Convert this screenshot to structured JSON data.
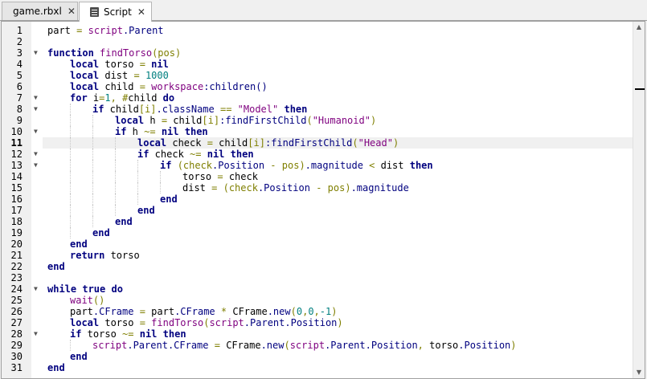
{
  "tabs": [
    {
      "label": "game.rbxl",
      "active": false,
      "close": "✕"
    },
    {
      "label": "Script",
      "active": true,
      "close": "✕"
    }
  ],
  "editor": {
    "current_line": 11,
    "lines": [
      {
        "n": "1",
        "fold": "",
        "indent": 0,
        "tokens": [
          [
            "part",
            "t"
          ],
          [
            " = ",
            "o"
          ],
          [
            "script",
            "b"
          ],
          [
            ".Parent",
            "m"
          ]
        ]
      },
      {
        "n": "2",
        "fold": "",
        "indent": 0,
        "tokens": []
      },
      {
        "n": "3",
        "fold": "▼",
        "indent": 0,
        "tokens": [
          [
            "function",
            "k"
          ],
          [
            " ",
            "t"
          ],
          [
            "findTorso",
            "b"
          ],
          [
            "(pos)",
            "o"
          ]
        ]
      },
      {
        "n": "4",
        "fold": "",
        "indent": 1,
        "tokens": [
          [
            "local",
            "k"
          ],
          [
            " torso ",
            "t"
          ],
          [
            "=",
            "o"
          ],
          [
            " ",
            "t"
          ],
          [
            "nil",
            "k"
          ]
        ]
      },
      {
        "n": "5",
        "fold": "",
        "indent": 1,
        "tokens": [
          [
            "local",
            "k"
          ],
          [
            " dist ",
            "t"
          ],
          [
            "=",
            "o"
          ],
          [
            " ",
            "t"
          ],
          [
            "1000",
            "n"
          ]
        ]
      },
      {
        "n": "6",
        "fold": "",
        "indent": 1,
        "tokens": [
          [
            "local",
            "k"
          ],
          [
            " child ",
            "t"
          ],
          [
            "=",
            "o"
          ],
          [
            " ",
            "t"
          ],
          [
            "workspace",
            "b"
          ],
          [
            ":children()",
            "m"
          ]
        ]
      },
      {
        "n": "7",
        "fold": "▼",
        "indent": 1,
        "tokens": [
          [
            "for",
            "k"
          ],
          [
            " i",
            "t"
          ],
          [
            "=",
            "o"
          ],
          [
            "1",
            "n"
          ],
          [
            ", ",
            "o"
          ],
          [
            "#",
            "o"
          ],
          [
            "child ",
            "t"
          ],
          [
            "do",
            "k"
          ]
        ]
      },
      {
        "n": "8",
        "fold": "▼",
        "indent": 2,
        "tokens": [
          [
            "if",
            "k"
          ],
          [
            " child",
            "t"
          ],
          [
            "[i]",
            "o"
          ],
          [
            ".className",
            "m"
          ],
          [
            " == ",
            "o"
          ],
          [
            "\"Model\"",
            "s"
          ],
          [
            " ",
            "t"
          ],
          [
            "then",
            "k"
          ]
        ]
      },
      {
        "n": "9",
        "fold": "",
        "indent": 3,
        "tokens": [
          [
            "local",
            "k"
          ],
          [
            " h ",
            "t"
          ],
          [
            "=",
            "o"
          ],
          [
            " child",
            "t"
          ],
          [
            "[i]",
            "o"
          ],
          [
            ":findFirstChild",
            "m"
          ],
          [
            "(",
            "o"
          ],
          [
            "\"Humanoid\"",
            "s"
          ],
          [
            ")",
            "o"
          ]
        ]
      },
      {
        "n": "10",
        "fold": "▼",
        "indent": 3,
        "tokens": [
          [
            "if",
            "k"
          ],
          [
            " h ",
            "t"
          ],
          [
            "~=",
            "o"
          ],
          [
            " ",
            "t"
          ],
          [
            "nil",
            "k"
          ],
          [
            " ",
            "t"
          ],
          [
            "then",
            "k"
          ]
        ]
      },
      {
        "n": "11",
        "fold": "",
        "indent": 4,
        "tokens": [
          [
            "local",
            "k"
          ],
          [
            " check ",
            "t"
          ],
          [
            "=",
            "o"
          ],
          [
            " child",
            "t"
          ],
          [
            "[i]",
            "o"
          ],
          [
            ":findFirstChild",
            "m"
          ],
          [
            "(",
            "o"
          ],
          [
            "\"Head\"",
            "s"
          ],
          [
            ")",
            "o"
          ]
        ]
      },
      {
        "n": "12",
        "fold": "▼",
        "indent": 4,
        "tokens": [
          [
            "if",
            "k"
          ],
          [
            " check ",
            "t"
          ],
          [
            "~=",
            "o"
          ],
          [
            " ",
            "t"
          ],
          [
            "nil",
            "k"
          ],
          [
            " ",
            "t"
          ],
          [
            "then",
            "k"
          ]
        ]
      },
      {
        "n": "13",
        "fold": "▼",
        "indent": 5,
        "tokens": [
          [
            "if",
            "k"
          ],
          [
            " ",
            "t"
          ],
          [
            "(check",
            "o"
          ],
          [
            ".Position",
            "m"
          ],
          [
            " - ",
            "o"
          ],
          [
            "pos)",
            "o"
          ],
          [
            ".magnitude",
            "m"
          ],
          [
            " < ",
            "o"
          ],
          [
            "dist ",
            "t"
          ],
          [
            "then",
            "k"
          ]
        ]
      },
      {
        "n": "14",
        "fold": "",
        "indent": 6,
        "tokens": [
          [
            "torso ",
            "t"
          ],
          [
            "=",
            "o"
          ],
          [
            " check",
            "t"
          ]
        ]
      },
      {
        "n": "15",
        "fold": "",
        "indent": 6,
        "tokens": [
          [
            "dist ",
            "t"
          ],
          [
            "=",
            "o"
          ],
          [
            " ",
            "t"
          ],
          [
            "(check",
            "o"
          ],
          [
            ".Position",
            "m"
          ],
          [
            " - ",
            "o"
          ],
          [
            "pos)",
            "o"
          ],
          [
            ".magnitude",
            "m"
          ]
        ]
      },
      {
        "n": "16",
        "fold": "",
        "indent": 5,
        "tokens": [
          [
            "end",
            "k"
          ]
        ]
      },
      {
        "n": "17",
        "fold": "",
        "indent": 4,
        "tokens": [
          [
            "end",
            "k"
          ]
        ]
      },
      {
        "n": "18",
        "fold": "",
        "indent": 3,
        "tokens": [
          [
            "end",
            "k"
          ]
        ]
      },
      {
        "n": "19",
        "fold": "",
        "indent": 2,
        "tokens": [
          [
            "end",
            "k"
          ]
        ]
      },
      {
        "n": "20",
        "fold": "",
        "indent": 1,
        "tokens": [
          [
            "end",
            "k"
          ]
        ]
      },
      {
        "n": "21",
        "fold": "",
        "indent": 1,
        "tokens": [
          [
            "return",
            "k"
          ],
          [
            " torso",
            "t"
          ]
        ]
      },
      {
        "n": "22",
        "fold": "",
        "indent": 0,
        "tokens": [
          [
            "end",
            "k"
          ]
        ]
      },
      {
        "n": "23",
        "fold": "",
        "indent": 0,
        "tokens": []
      },
      {
        "n": "24",
        "fold": "▼",
        "indent": 0,
        "tokens": [
          [
            "while",
            "k"
          ],
          [
            " ",
            "t"
          ],
          [
            "true",
            "k"
          ],
          [
            " ",
            "t"
          ],
          [
            "do",
            "k"
          ]
        ]
      },
      {
        "n": "25",
        "fold": "",
        "indent": 1,
        "tokens": [
          [
            "wait",
            "b"
          ],
          [
            "()",
            "o"
          ]
        ]
      },
      {
        "n": "26",
        "fold": "",
        "indent": 1,
        "tokens": [
          [
            "part",
            "t"
          ],
          [
            ".CFrame",
            "m"
          ],
          [
            " = ",
            "o"
          ],
          [
            "part",
            "t"
          ],
          [
            ".CFrame",
            "m"
          ],
          [
            " * ",
            "o"
          ],
          [
            "CFrame",
            "t"
          ],
          [
            ".new",
            "m"
          ],
          [
            "(",
            "o"
          ],
          [
            "0",
            "n"
          ],
          [
            ",",
            "o"
          ],
          [
            "0",
            "n"
          ],
          [
            ",",
            "o"
          ],
          [
            "-1",
            "n"
          ],
          [
            ")",
            "o"
          ]
        ]
      },
      {
        "n": "27",
        "fold": "",
        "indent": 1,
        "tokens": [
          [
            "local",
            "k"
          ],
          [
            " torso ",
            "t"
          ],
          [
            "=",
            "o"
          ],
          [
            " ",
            "t"
          ],
          [
            "findTorso",
            "b"
          ],
          [
            "(",
            "o"
          ],
          [
            "script",
            "b"
          ],
          [
            ".Parent",
            "m"
          ],
          [
            ".Position",
            "m"
          ],
          [
            ")",
            "o"
          ]
        ]
      },
      {
        "n": "28",
        "fold": "▼",
        "indent": 1,
        "tokens": [
          [
            "if",
            "k"
          ],
          [
            " torso ",
            "t"
          ],
          [
            "~=",
            "o"
          ],
          [
            " ",
            "t"
          ],
          [
            "nil",
            "k"
          ],
          [
            " ",
            "t"
          ],
          [
            "then",
            "k"
          ]
        ]
      },
      {
        "n": "29",
        "fold": "",
        "indent": 2,
        "tokens": [
          [
            "script",
            "b"
          ],
          [
            ".Parent",
            "m"
          ],
          [
            ".CFrame",
            "m"
          ],
          [
            " = ",
            "o"
          ],
          [
            "CFrame",
            "t"
          ],
          [
            ".new",
            "m"
          ],
          [
            "(",
            "o"
          ],
          [
            "script",
            "b"
          ],
          [
            ".Parent",
            "m"
          ],
          [
            ".Position",
            "m"
          ],
          [
            ", ",
            "o"
          ],
          [
            "torso",
            "t"
          ],
          [
            ".Position",
            "m"
          ],
          [
            ")",
            "o"
          ]
        ]
      },
      {
        "n": "30",
        "fold": "",
        "indent": 1,
        "tokens": [
          [
            "end",
            "k"
          ]
        ]
      },
      {
        "n": "31",
        "fold": "",
        "indent": 0,
        "tokens": [
          [
            "end",
            "k"
          ]
        ]
      }
    ]
  },
  "scrollbar": {
    "up_arrow": "▲",
    "down_arrow": "▼"
  }
}
